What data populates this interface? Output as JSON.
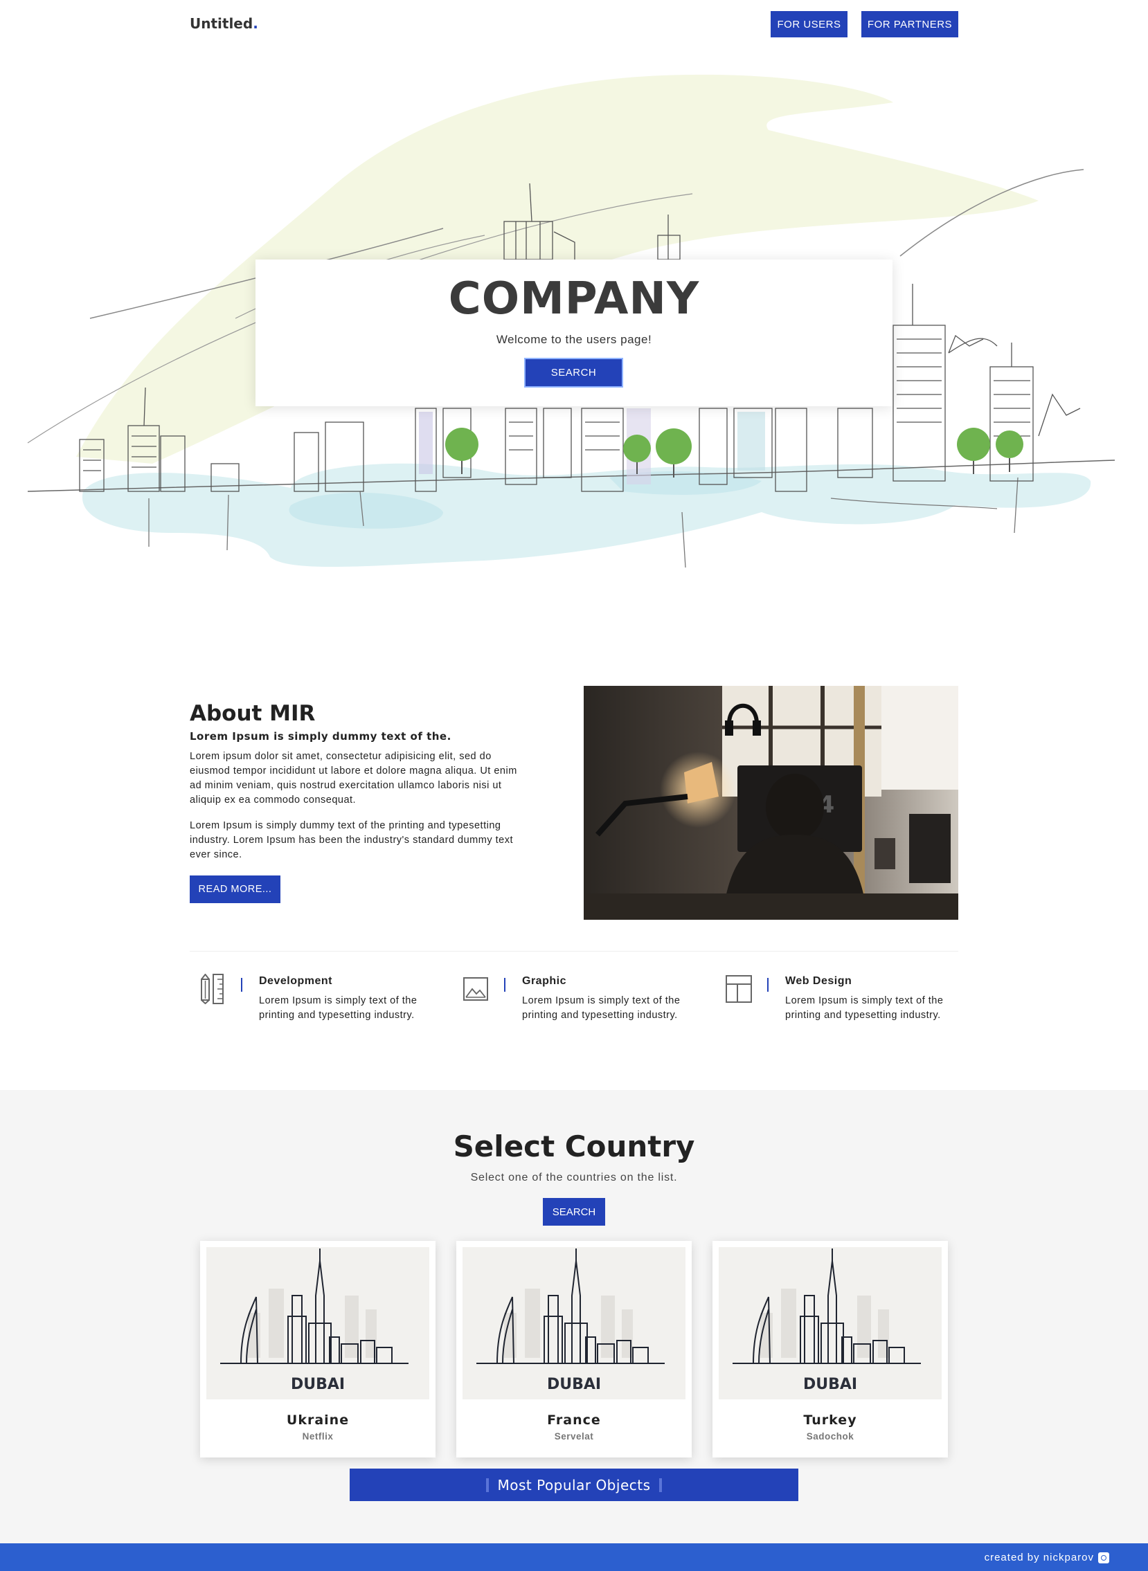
{
  "nav": {
    "brand": "Untitled",
    "brand_dot": ".",
    "for_users": "FOR USERS",
    "for_partners": "FOR PARTNERS"
  },
  "hero": {
    "title": "COMPANY",
    "subtitle": "Welcome to the users page!",
    "search_label": "SEARCH"
  },
  "about": {
    "title": "About MIR",
    "lead": "Lorem Ipsum is simply dummy text of the.",
    "paragraph1": "Lorem ipsum dolor sit amet, consectetur adipisicing elit, sed do eiusmod tempor incididunt ut labore et dolore magna aliqua. Ut enim ad minim veniam, quis nostrud exercitation ullamco laboris nisi ut aliquip ex ea commodo consequat.",
    "paragraph2": "Lorem Ipsum is simply dummy text of the printing and typesetting industry. Lorem Ipsum has been the industry's standard dummy text ever since.",
    "read_more": "READ MORE...",
    "photo_number": "54"
  },
  "features": [
    {
      "icon": "ruler-pencil-icon",
      "title": "Development",
      "text": "Lorem Ipsum is simply text of the printing and typesetting industry."
    },
    {
      "icon": "image-icon",
      "title": "Graphic",
      "text": "Lorem Ipsum is simply text of the printing and typesetting industry."
    },
    {
      "icon": "layout-icon",
      "title": "Web Design",
      "text": "Lorem Ipsum is simply text of the printing and typesetting industry."
    }
  ],
  "countries": {
    "title": "Select Country",
    "subtitle": "Select one of the countries on the list.",
    "search_label": "SEARCH",
    "cards": [
      {
        "name": "Ukraine",
        "sub": "Netflix",
        "image_caption": "DUBAI"
      },
      {
        "name": "France",
        "sub": "Servelat",
        "image_caption": "DUBAI"
      },
      {
        "name": "Turkey",
        "sub": "Sadochok",
        "image_caption": "DUBAI"
      }
    ],
    "popular_label": "Most Popular Objects"
  },
  "footer": {
    "credit": "created by nickparov"
  },
  "colors": {
    "accent": "#2342b8",
    "footer": "#2c5fcf",
    "section_bg": "#f5f5f5"
  }
}
